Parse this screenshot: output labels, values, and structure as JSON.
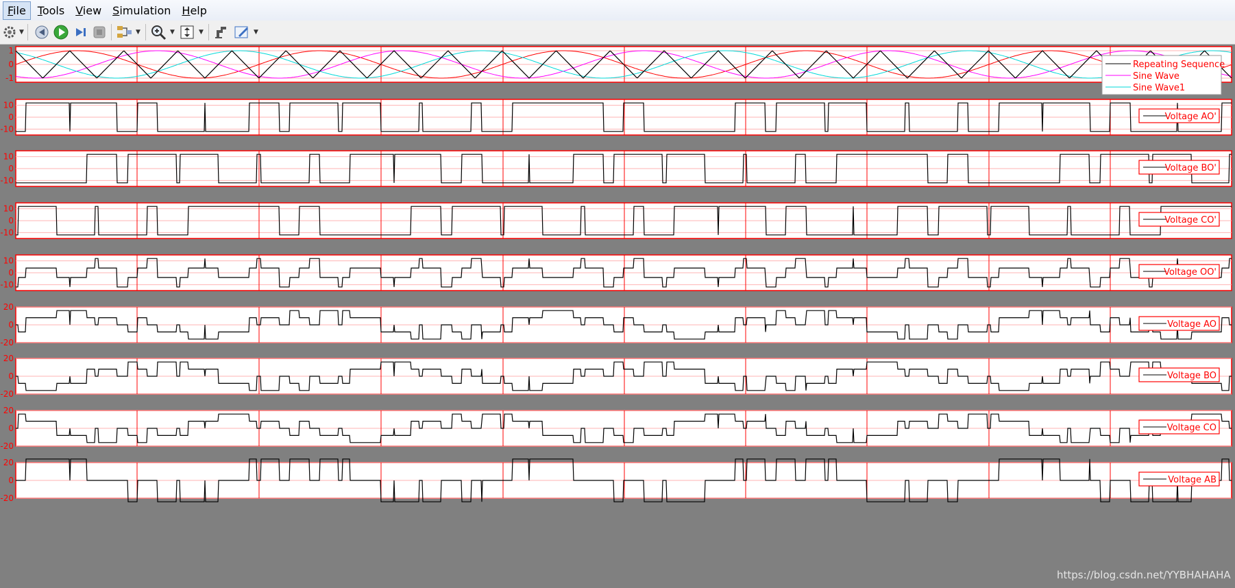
{
  "menubar": {
    "items": [
      {
        "label": "File",
        "mn": "F",
        "rest": "ile"
      },
      {
        "label": "Tools",
        "mn": "T",
        "rest": "ools"
      },
      {
        "label": "View",
        "mn": "V",
        "rest": "iew"
      },
      {
        "label": "Simulation",
        "mn": "S",
        "rest": "imulation"
      },
      {
        "label": "Help",
        "mn": "H",
        "rest": "elp"
      }
    ]
  },
  "toolbar": {
    "icons": [
      "gear-icon",
      "rewind-icon",
      "run-icon",
      "step-forward-icon",
      "stop-icon",
      "signal-selector-icon",
      "zoom-icon",
      "autoscale-icon",
      "highlight-block-icon",
      "style-icon"
    ]
  },
  "colors": {
    "axes_red": "#ff0000",
    "plot_bg": "#ffffff",
    "figure_bg": "#808080",
    "grid": "#ffb3b3",
    "trace_black": "#000000",
    "trace_magenta": "#ff00ff",
    "trace_cyan": "#00d8d8",
    "trace_red": "#ff0000"
  },
  "chart_data": [
    {
      "type": "line",
      "yticks": [
        -1,
        0,
        1
      ],
      "ylim": [
        -1.3,
        1.3
      ],
      "legend": [
        "Repeating Sequence",
        "Sine Wave",
        "Sine Wave1"
      ],
      "legend_position": "right"
    },
    {
      "type": "line",
      "yticks": [
        -10,
        0,
        10
      ],
      "ylim": [
        -15,
        15
      ],
      "legend": [
        "Voltage AO'"
      ],
      "legend_position": "right"
    },
    {
      "type": "line",
      "yticks": [
        -10,
        0,
        10
      ],
      "ylim": [
        -15,
        15
      ],
      "legend": [
        "Voltage BO'"
      ],
      "legend_position": "right"
    },
    {
      "type": "line",
      "yticks": [
        -10,
        0,
        10
      ],
      "ylim": [
        -15,
        15
      ],
      "legend": [
        "Voltage CO'"
      ],
      "legend_position": "right"
    },
    {
      "type": "line",
      "yticks": [
        -10,
        0,
        10
      ],
      "ylim": [
        -15,
        15
      ],
      "legend": [
        "Voltage OO'"
      ],
      "legend_position": "right"
    },
    {
      "type": "line",
      "yticks": [
        -20,
        0,
        20
      ],
      "ylim": [
        -20,
        20
      ],
      "legend": [
        "Voltage AO"
      ],
      "legend_position": "right"
    },
    {
      "type": "line",
      "yticks": [
        -20,
        0,
        20
      ],
      "ylim": [
        -20,
        20
      ],
      "legend": [
        "Voltage BO"
      ],
      "legend_position": "right"
    },
    {
      "type": "line",
      "yticks": [
        -20,
        0,
        20
      ],
      "ylim": [
        -20,
        20
      ],
      "legend": [
        "Voltage CO"
      ],
      "legend_position": "right"
    },
    {
      "type": "line",
      "yticks": [
        -20,
        0,
        20
      ],
      "ylim": [
        -20,
        20
      ],
      "legend": [
        "Voltage AB"
      ],
      "legend_position": "right"
    }
  ],
  "watermark": "https://blog.csdn.net/YYBHAHAHA"
}
